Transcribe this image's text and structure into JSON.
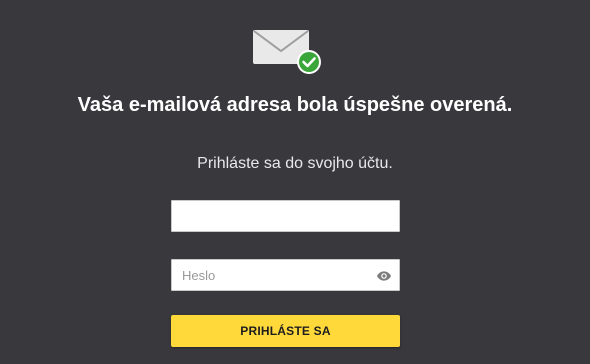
{
  "header": {
    "icon": "mail-verified-icon",
    "title": "Vaša e-mailová adresa bola úspešne overená.",
    "subtitle": "Prihláste sa do svojho účtu."
  },
  "form": {
    "email": {
      "value": "",
      "placeholder": ""
    },
    "password": {
      "value": "",
      "placeholder": "Heslo",
      "toggle_icon": "eye-icon"
    },
    "submit_label": "PRIHLÁSTE SA"
  },
  "colors": {
    "background": "#38383d",
    "accent": "#ffd83a",
    "success": "#3aa63a"
  }
}
